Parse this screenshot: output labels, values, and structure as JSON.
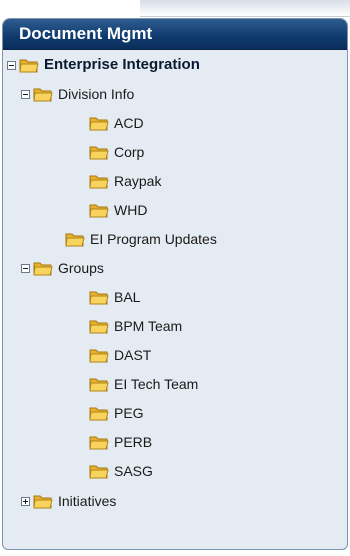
{
  "panel": {
    "title": "Document Mgmt"
  },
  "tree": {
    "root": {
      "label": "Enterprise Integration",
      "state": "expanded",
      "icon": "folder-icon"
    },
    "division_info": {
      "label": "Division Info",
      "state": "expanded",
      "icon": "folder-icon"
    },
    "division_children": [
      {
        "label": "ACD",
        "icon": "folder-icon"
      },
      {
        "label": "Corp",
        "icon": "folder-icon"
      },
      {
        "label": "Raypak",
        "icon": "folder-icon"
      },
      {
        "label": "WHD",
        "icon": "folder-icon"
      }
    ],
    "ei_program_updates": {
      "label": "EI Program Updates",
      "icon": "folder-icon"
    },
    "groups": {
      "label": "Groups",
      "state": "expanded",
      "icon": "folder-icon"
    },
    "group_children": [
      {
        "label": "BAL",
        "icon": "folder-icon"
      },
      {
        "label": "BPM Team",
        "icon": "folder-icon"
      },
      {
        "label": "DAST",
        "icon": "folder-icon"
      },
      {
        "label": "EI Tech Team",
        "icon": "folder-icon"
      },
      {
        "label": "PEG",
        "icon": "folder-icon"
      },
      {
        "label": "PERB",
        "icon": "folder-icon"
      },
      {
        "label": "SASG",
        "icon": "folder-icon"
      }
    ],
    "initiatives": {
      "label": "Initiatives",
      "state": "collapsed",
      "icon": "folder-icon"
    }
  },
  "colors": {
    "header_bg": "#0f3a6e",
    "panel_bg": "#e5ebf2",
    "folder_fill": "#f6c94a"
  }
}
